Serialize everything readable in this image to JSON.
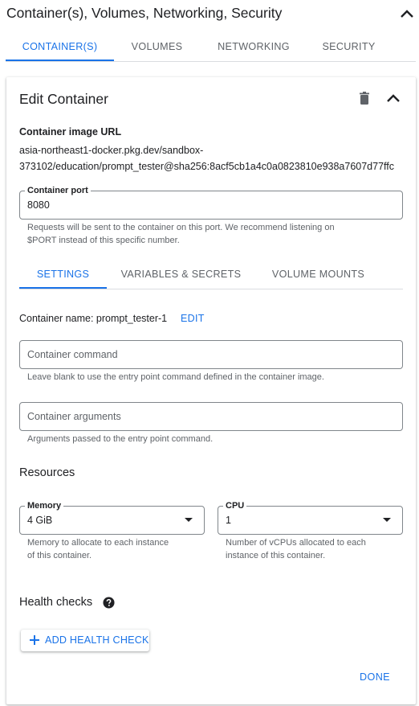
{
  "section": {
    "title": "Container(s), Volumes, Networking, Security"
  },
  "top_tabs": [
    {
      "label": "CONTAINER(S)",
      "active": true
    },
    {
      "label": "VOLUMES",
      "active": false
    },
    {
      "label": "NETWORKING",
      "active": false
    },
    {
      "label": "SECURITY",
      "active": false
    }
  ],
  "card": {
    "title": "Edit Container",
    "image_url_label": "Container image URL",
    "image_url_line1": "asia-northeast1-docker.pkg.dev/sandbox-",
    "image_url_line2": "373102/education/prompt_tester@sha256:8acf5cb1a4c0a0823810e938a7607d77ffc",
    "port": {
      "label": "Container port",
      "value": "8080",
      "hint_line1": "Requests will be sent to the container on this port. We recommend listening on",
      "hint_line2": "$PORT instead of this specific number."
    },
    "sub_tabs": [
      {
        "label": "SETTINGS",
        "active": true
      },
      {
        "label": "VARIABLES & SECRETS",
        "active": false
      },
      {
        "label": "VOLUME MOUNTS",
        "active": false
      }
    ],
    "container_name_text": "Container name: prompt_tester-1",
    "edit_label": "EDIT",
    "command": {
      "placeholder": "Container command",
      "hint": "Leave blank to use the entry point command defined in the container image."
    },
    "arguments": {
      "placeholder": "Container arguments",
      "hint": "Arguments passed to the entry point command."
    },
    "resources_title": "Resources",
    "memory": {
      "label": "Memory",
      "value": "4 GiB",
      "hint_line1": "Memory to allocate to each instance",
      "hint_line2": "of this container."
    },
    "cpu": {
      "label": "CPU",
      "value": "1",
      "hint_line1": "Number of vCPUs allocated to each",
      "hint_line2": "instance of this container."
    },
    "health_title": "Health checks",
    "add_health_label": "ADD HEALTH CHECK",
    "done_label": "DONE"
  },
  "colors": {
    "accent": "#1a73e8",
    "text": "#202124",
    "muted": "#5f6368",
    "border": "#dadce0"
  },
  "icons": [
    "chevron-up-icon",
    "delete-icon",
    "help-icon",
    "plus-icon",
    "dropdown-caret-icon"
  ]
}
